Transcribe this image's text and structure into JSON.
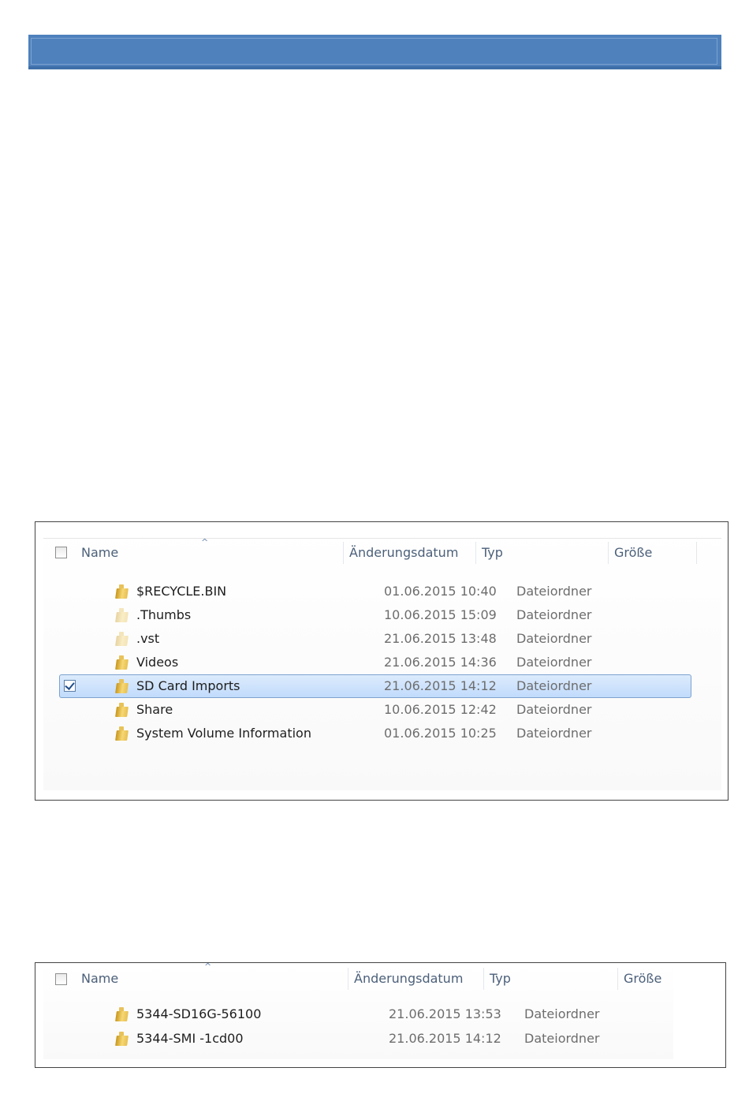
{
  "colors": {
    "header_bar": "#4f81bd",
    "selection": "#c1dbfc",
    "header_text": "#4c607a"
  },
  "explorer1": {
    "columns": {
      "name": "Name",
      "date": "Änderungsdatum",
      "type": "Typ",
      "size": "Größe"
    },
    "rows": [
      {
        "name": "$RECYCLE.BIN",
        "date": "01.06.2015 10:40",
        "type": "Dateiordner",
        "icon": "folder-icon",
        "selected": false
      },
      {
        "name": ".Thumbs",
        "date": "10.06.2015 15:09",
        "type": "Dateiordner",
        "icon": "folder-icon",
        "selected": false
      },
      {
        "name": ".vst",
        "date": "21.06.2015 13:48",
        "type": "Dateiordner",
        "icon": "folder-icon",
        "selected": false
      },
      {
        "name": "Videos",
        "date": "21.06.2015 14:36",
        "type": "Dateiordner",
        "icon": "folder-icon",
        "selected": false
      },
      {
        "name": "SD Card Imports",
        "date": "21.06.2015 14:12",
        "type": "Dateiordner",
        "icon": "folder-icon",
        "selected": true
      },
      {
        "name": "Share",
        "date": "10.06.2015 12:42",
        "type": "Dateiordner",
        "icon": "folder-icon",
        "selected": false
      },
      {
        "name": "System Volume Information",
        "date": "01.06.2015 10:25",
        "type": "Dateiordner",
        "icon": "folder-icon",
        "selected": false
      }
    ]
  },
  "explorer2": {
    "columns": {
      "name": "Name",
      "date": "Änderungsdatum",
      "type": "Typ",
      "size": "Größe"
    },
    "rows": [
      {
        "name": "5344-SD16G-56100",
        "date": "21.06.2015 13:53",
        "type": "Dateiordner",
        "icon": "folder-icon"
      },
      {
        "name": "5344-SMI -1cd00",
        "date": "21.06.2015 14:12",
        "type": "Dateiordner",
        "icon": "folder-icon"
      }
    ]
  }
}
